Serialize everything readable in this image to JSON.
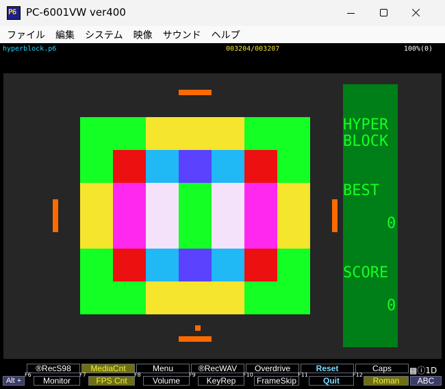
{
  "window": {
    "app_icon_text": "P6",
    "title": "PC-6001VW ver400"
  },
  "menu": [
    "ファイル",
    "編集",
    "システム",
    "映像",
    "サウンド",
    "ヘルプ"
  ],
  "info": {
    "filename": "hyperblock.p6",
    "frames": "003204/003207",
    "speed": "100%(0)"
  },
  "game": {
    "panel": {
      "title_line1": "HYPER",
      "title_line2": "BLOCK",
      "best_label": "BEST",
      "best_value": "0",
      "score_label": "SCORE",
      "score_value": "0"
    },
    "colors": {
      "G": "#14ff24",
      "Y": "#f5e52c",
      "R": "#ec1010",
      "C": "#20b8f5",
      "B": "#5a42ff",
      "M": "#ff28ef",
      "W": "#f4e2fa",
      "paddle": "#ff6a00",
      "panel": "#007e17",
      "background": "#262626"
    },
    "grid": [
      "GGYYYGGx",
      "GRCBCRGx",
      "YMWGWMYx",
      "YMWGWMYx",
      "GRCBCRGx",
      "GGYYYGGx"
    ]
  },
  "function_keys": {
    "alt_label": "Alt +",
    "row1": [
      {
        "label": "®RecS98",
        "highlight": false
      },
      {
        "label": "MediaCnt",
        "highlight": true
      },
      {
        "label": "Menu",
        "highlight": false
      },
      {
        "label": "®RecWAV",
        "highlight": false
      },
      {
        "label": "Overdrive",
        "highlight": false
      },
      {
        "label": "Reset",
        "highlight": false,
        "active": true
      },
      {
        "label": "Caps",
        "highlight": false
      }
    ],
    "row2": [
      {
        "key": "F6",
        "label": "Monitor",
        "highlight": false
      },
      {
        "key": "F7",
        "label": "FPS Cnt",
        "highlight": true
      },
      {
        "key": "F8",
        "label": "Volume",
        "highlight": false
      },
      {
        "key": "F9",
        "label": "KeyRep",
        "highlight": false
      },
      {
        "key": "F10",
        "label": "FrameSkip",
        "highlight": false
      },
      {
        "key": "F11",
        "label": "Quit",
        "highlight": false,
        "active": true
      },
      {
        "key": "F12",
        "label": "Roman",
        "highlight": true
      },
      {
        "key": "",
        "label": "ABC",
        "highlight": false,
        "blue": true
      }
    ],
    "status": "1D"
  }
}
